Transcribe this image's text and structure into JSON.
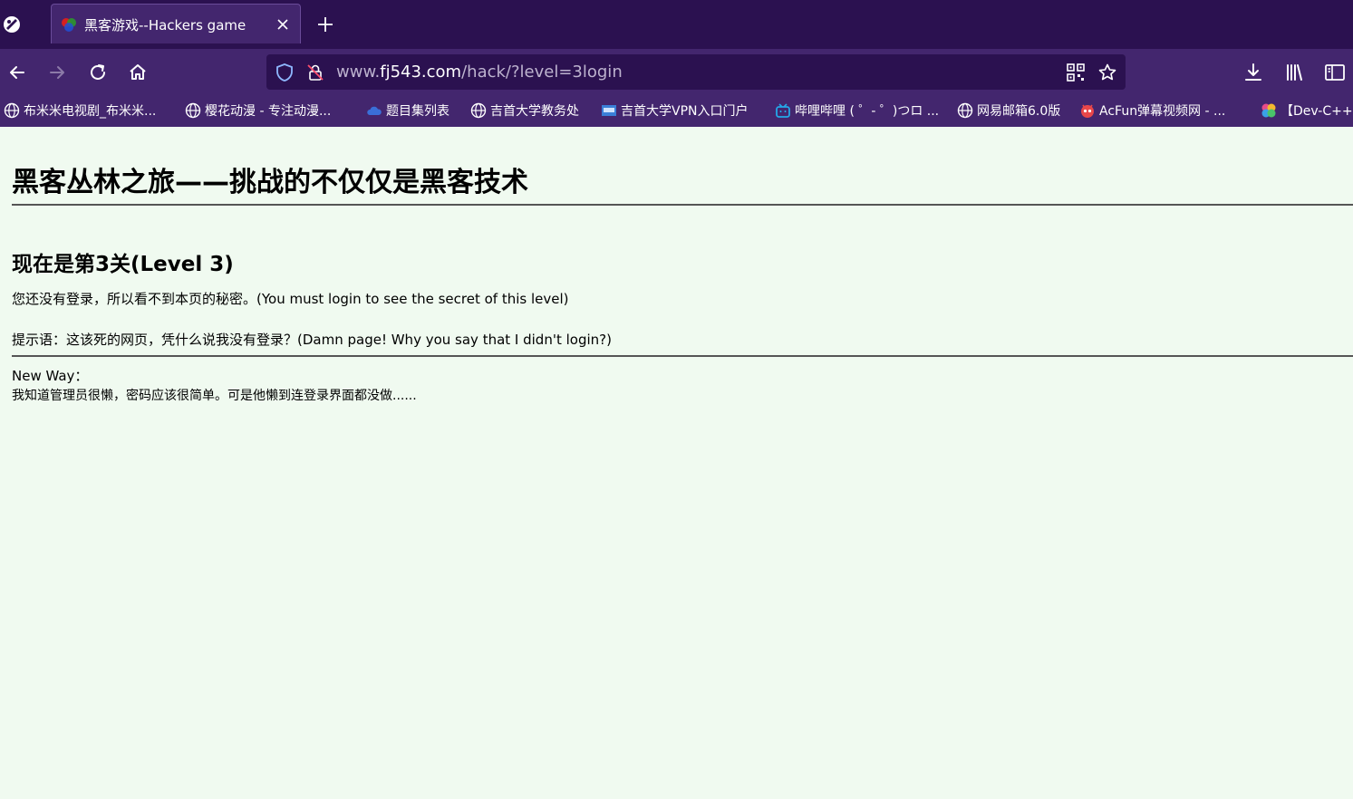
{
  "browser": {
    "tab": {
      "title": "黑客游戏--Hackers game"
    },
    "url": {
      "prefix": "www.",
      "domain": "fj543.com",
      "path": "/hack/?level=3login"
    },
    "icons": {
      "back": "arrow-left-icon",
      "forward": "arrow-right-icon",
      "reload": "reload-icon",
      "home": "home-icon",
      "download": "download-icon",
      "library": "library-icon",
      "sidebar": "sidebar-icon"
    },
    "bookmarks": [
      "布米米电视剧_布米米...",
      "樱花动漫 - 专注动漫...",
      "题目集列表",
      "吉首大学教务处",
      "吉首大学VPN入口门户",
      "哔哩哔哩 ( ゜- ゜)つロ ...",
      "网易邮箱6.0版",
      "AcFun弹幕视频网 - ...",
      "【Dev-C++"
    ]
  },
  "page": {
    "title": "黑客丛林之旅——挑战的不仅仅是黑客技术",
    "level_heading": "现在是第3关(Level 3)",
    "message": "您还没有登录，所以看不到本页的秘密。(You must login to see the secret of this level)",
    "hint": "提示语：这该死的网页，凭什么说我没有登录？(Damn page! Why you say that I didn't login?)",
    "new_way_label": "New Way：",
    "new_way_text": "我知道管理员很懒，密码应该很简单。可是他懒到连登录界面都没做......"
  }
}
